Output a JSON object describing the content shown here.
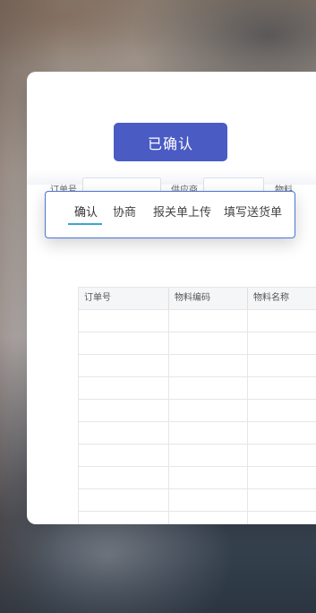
{
  "status": {
    "label": "已确认"
  },
  "tabs": [
    {
      "label": "确认",
      "active": true
    },
    {
      "label": "协商",
      "active": false
    },
    {
      "label": "报关单上传",
      "active": false
    },
    {
      "label": "填写送货单",
      "active": false
    }
  ],
  "search": {
    "order_no_label": "订单号",
    "supplier_label": "供应商",
    "material_label": "物料"
  },
  "table": {
    "columns": [
      "订单号",
      "物料编码",
      "物料名称"
    ],
    "rows": [
      [
        "",
        "",
        ""
      ],
      [
        "",
        "",
        ""
      ],
      [
        "",
        "",
        ""
      ],
      [
        "",
        "",
        ""
      ],
      [
        "",
        "",
        ""
      ],
      [
        "",
        "",
        ""
      ],
      [
        "",
        "",
        ""
      ],
      [
        "",
        "",
        ""
      ],
      [
        "",
        "",
        ""
      ],
      [
        "",
        "",
        ""
      ]
    ]
  },
  "colors": {
    "accent": "#4a5bc4",
    "tab_border": "#4a76d8",
    "tab_indicator": "#3ba7c9"
  }
}
